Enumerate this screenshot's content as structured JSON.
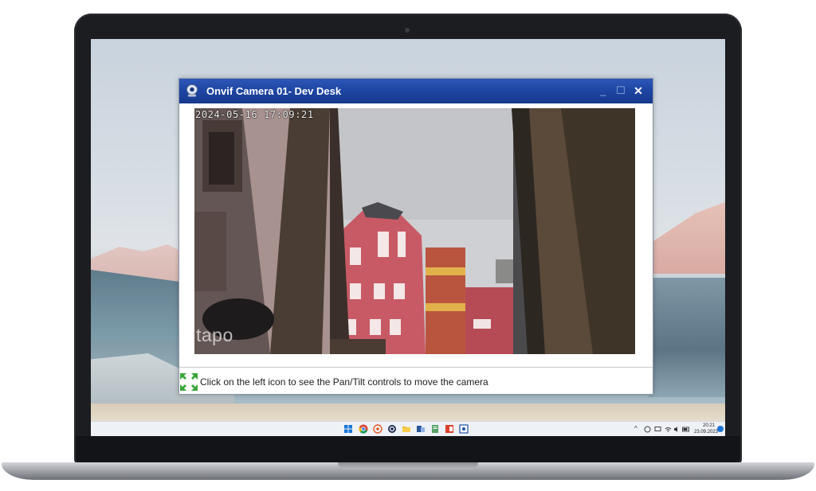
{
  "window": {
    "title": "Onvif Camera 01- Dev Desk",
    "minimize_glyph": "_",
    "maximize_glyph": "☐",
    "close_glyph": "✕"
  },
  "camera": {
    "timestamp": "2024-05-16 17:09:21",
    "watermark": "tapo"
  },
  "status": {
    "ptz_icon": "expand-arrows-icon",
    "hint": "Click on the left icon to see the Pan/Tilt controls to move the camera"
  },
  "taskbar": {
    "apps": [
      "start-icon",
      "chrome-icon",
      "app-icon",
      "app-icon",
      "folder-icon",
      "app-icon",
      "app-icon",
      "app-icon",
      "app-icon"
    ],
    "tray": {
      "chevron": "^",
      "clock_time": "20:21",
      "clock_date": "23.09.2023"
    }
  },
  "colors": {
    "titlebar": "#1e46a3",
    "taskbar": "#eef1f6",
    "accent": "#1b74d6"
  }
}
